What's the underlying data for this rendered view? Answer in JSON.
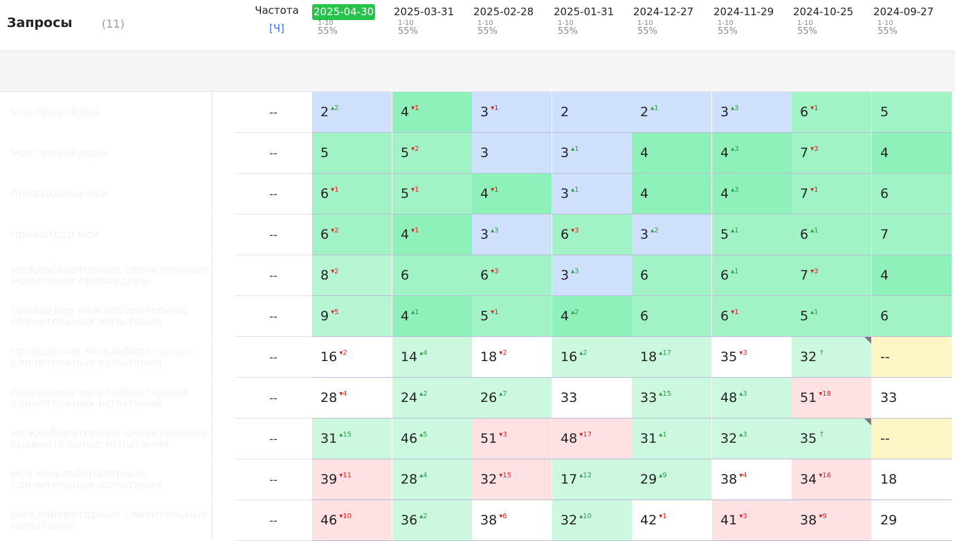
{
  "header": {
    "title": "Запросы",
    "count": "(11)",
    "freq_label": "Частота",
    "freq_unit": "[Ч]",
    "dates": [
      {
        "date": "2025-04-30",
        "range": "1-10",
        "pct": "55%",
        "active": true
      },
      {
        "date": "2025-03-31",
        "range": "1-10",
        "pct": "55%"
      },
      {
        "date": "2025-02-28",
        "range": "1-10",
        "pct": "55%"
      },
      {
        "date": "2025-01-31",
        "range": "1-10",
        "pct": "55%"
      },
      {
        "date": "2024-12-27",
        "range": "1-10",
        "pct": "55%"
      },
      {
        "date": "2024-11-29",
        "range": "1-10",
        "pct": "55%"
      },
      {
        "date": "2024-10-25",
        "range": "1-10",
        "pct": "55%"
      },
      {
        "date": "2024-09-27",
        "range": "1-10",
        "pct": "55%"
      }
    ]
  },
  "colors": {
    "active_date": "#27c24c",
    "blue": "#cfe0fc",
    "green_dark": "#8ef1b9",
    "green": "#a1f3c5",
    "green_light": "#b6f6d2",
    "green_pale": "#cdf8e0",
    "white": "#ffffff",
    "red": "#fde1e3",
    "yellow": "#fdf5c6",
    "up_arrow": "#2e9b48",
    "down_arrow": "#e02020"
  },
  "rows": [
    {
      "keyword": "мси провайдер",
      "freq": "--",
      "cells": [
        {
          "v": "2",
          "ch": "2",
          "dir": "up",
          "c": "blue"
        },
        {
          "v": "4",
          "ch": "1",
          "dir": "dn",
          "c": "g1"
        },
        {
          "v": "3",
          "ch": "1",
          "dir": "dn",
          "c": "blue"
        },
        {
          "v": "2",
          "c": "blue"
        },
        {
          "v": "2",
          "ch": "1",
          "dir": "up",
          "c": "blue"
        },
        {
          "v": "3",
          "ch": "3",
          "dir": "up",
          "c": "blue"
        },
        {
          "v": "6",
          "ch": "1",
          "dir": "dn",
          "c": "g2"
        },
        {
          "v": "5",
          "c": "g2"
        }
      ]
    },
    {
      "keyword": "мси провайдеры",
      "freq": "--",
      "cells": [
        {
          "v": "5",
          "c": "g2"
        },
        {
          "v": "5",
          "ch": "2",
          "dir": "dn",
          "c": "g2"
        },
        {
          "v": "3",
          "c": "blue"
        },
        {
          "v": "3",
          "ch": "1",
          "dir": "up",
          "c": "blue"
        },
        {
          "v": "4",
          "c": "g1"
        },
        {
          "v": "4",
          "ch": "3",
          "dir": "up",
          "c": "g1"
        },
        {
          "v": "7",
          "ch": "3",
          "dir": "dn",
          "c": "g2"
        },
        {
          "v": "4",
          "c": "g1"
        }
      ]
    },
    {
      "keyword": "провайдеры мси",
      "freq": "--",
      "cells": [
        {
          "v": "6",
          "ch": "1",
          "dir": "dn",
          "c": "g2"
        },
        {
          "v": "5",
          "ch": "1",
          "dir": "dn",
          "c": "g2"
        },
        {
          "v": "4",
          "ch": "1",
          "dir": "dn",
          "c": "g1"
        },
        {
          "v": "3",
          "ch": "1",
          "dir": "up",
          "c": "blue"
        },
        {
          "v": "4",
          "c": "g1"
        },
        {
          "v": "4",
          "ch": "3",
          "dir": "up",
          "c": "g1"
        },
        {
          "v": "7",
          "ch": "1",
          "dir": "dn",
          "c": "g2"
        },
        {
          "v": "6",
          "c": "g2"
        }
      ]
    },
    {
      "keyword": "провайдер мси",
      "freq": "--",
      "cells": [
        {
          "v": "6",
          "ch": "2",
          "dir": "dn",
          "c": "g2"
        },
        {
          "v": "4",
          "ch": "1",
          "dir": "dn",
          "c": "g1"
        },
        {
          "v": "3",
          "ch": "3",
          "dir": "up",
          "c": "blue"
        },
        {
          "v": "6",
          "ch": "3",
          "dir": "dn",
          "c": "g2"
        },
        {
          "v": "3",
          "ch": "2",
          "dir": "up",
          "c": "blue"
        },
        {
          "v": "5",
          "ch": "1",
          "dir": "up",
          "c": "g2"
        },
        {
          "v": "6",
          "ch": "1",
          "dir": "up",
          "c": "g2"
        },
        {
          "v": "7",
          "c": "g2"
        }
      ]
    },
    {
      "keyword": "межлабораторные сличительные испытания провайдеры",
      "freq": "--",
      "cells": [
        {
          "v": "8",
          "ch": "2",
          "dir": "dn",
          "c": "g3"
        },
        {
          "v": "6",
          "c": "g2"
        },
        {
          "v": "6",
          "ch": "3",
          "dir": "dn",
          "c": "g2"
        },
        {
          "v": "3",
          "ch": "3",
          "dir": "up",
          "c": "blue"
        },
        {
          "v": "6",
          "c": "g2"
        },
        {
          "v": "6",
          "ch": "1",
          "dir": "up",
          "c": "g2"
        },
        {
          "v": "7",
          "ch": "3",
          "dir": "dn",
          "c": "g2"
        },
        {
          "v": "4",
          "c": "g1"
        }
      ]
    },
    {
      "keyword": "провайдер межлабораторных сличительных испытаний",
      "freq": "--",
      "cells": [
        {
          "v": "9",
          "ch": "5",
          "dir": "dn",
          "c": "g3"
        },
        {
          "v": "4",
          "ch": "1",
          "dir": "up",
          "c": "g1"
        },
        {
          "v": "5",
          "ch": "1",
          "dir": "dn",
          "c": "g2"
        },
        {
          "v": "4",
          "ch": "2",
          "dir": "up",
          "c": "g1"
        },
        {
          "v": "6",
          "c": "g2"
        },
        {
          "v": "6",
          "ch": "1",
          "dir": "dn",
          "c": "g2"
        },
        {
          "v": "5",
          "ch": "1",
          "dir": "up",
          "c": "g2"
        },
        {
          "v": "6",
          "c": "g2"
        }
      ]
    },
    {
      "keyword": "проведение межлабораторных сличительных испытаний",
      "freq": "--",
      "cells": [
        {
          "v": "16",
          "ch": "2",
          "dir": "dn",
          "c": "w"
        },
        {
          "v": "14",
          "ch": "4",
          "dir": "up",
          "c": "g4"
        },
        {
          "v": "18",
          "ch": "2",
          "dir": "dn",
          "c": "w"
        },
        {
          "v": "16",
          "ch": "2",
          "dir": "up",
          "c": "g4"
        },
        {
          "v": "18",
          "ch": "17",
          "dir": "up",
          "c": "g4"
        },
        {
          "v": "35",
          "ch": "3",
          "dir": "dn",
          "c": "w"
        },
        {
          "v": "32",
          "ch": "↑",
          "dir": "up",
          "c": "g4",
          "corner": true
        },
        {
          "v": "--",
          "c": "y"
        }
      ]
    },
    {
      "keyword": "программа межлабораторных сличительных испытаний",
      "freq": "--",
      "cells": [
        {
          "v": "28",
          "ch": "4",
          "dir": "dn",
          "c": "w"
        },
        {
          "v": "24",
          "ch": "2",
          "dir": "up",
          "c": "g4"
        },
        {
          "v": "26",
          "ch": "7",
          "dir": "up",
          "c": "g4"
        },
        {
          "v": "33",
          "c": "w"
        },
        {
          "v": "33",
          "ch": "15",
          "dir": "up",
          "c": "g4"
        },
        {
          "v": "48",
          "ch": "3",
          "dir": "up",
          "c": "g4"
        },
        {
          "v": "51",
          "ch": "18",
          "dir": "dn",
          "c": "r"
        },
        {
          "v": "33",
          "c": "w"
        }
      ]
    },
    {
      "keyword": "межлабораторные сличительные сравнительные испытания",
      "freq": "--",
      "cells": [
        {
          "v": "31",
          "ch": "15",
          "dir": "up",
          "c": "g4"
        },
        {
          "v": "46",
          "ch": "5",
          "dir": "up",
          "c": "g4"
        },
        {
          "v": "51",
          "ch": "3",
          "dir": "dn",
          "c": "r"
        },
        {
          "v": "48",
          "ch": "17",
          "dir": "dn",
          "c": "r"
        },
        {
          "v": "31",
          "ch": "1",
          "dir": "up",
          "c": "g4"
        },
        {
          "v": "32",
          "ch": "3",
          "dir": "up",
          "c": "g4"
        },
        {
          "v": "35",
          "ch": "↑",
          "dir": "up",
          "c": "g4",
          "corner": true
        },
        {
          "v": "--",
          "c": "y"
        }
      ]
    },
    {
      "keyword": "мси межлабораторные сличительные испытания",
      "freq": "--",
      "cells": [
        {
          "v": "39",
          "ch": "11",
          "dir": "dn",
          "c": "r"
        },
        {
          "v": "28",
          "ch": "4",
          "dir": "up",
          "c": "g4"
        },
        {
          "v": "32",
          "ch": "15",
          "dir": "dn",
          "c": "r"
        },
        {
          "v": "17",
          "ch": "12",
          "dir": "up",
          "c": "g4"
        },
        {
          "v": "29",
          "ch": "9",
          "dir": "up",
          "c": "g4"
        },
        {
          "v": "38",
          "ch": "4",
          "dir": "dn",
          "c": "w"
        },
        {
          "v": "34",
          "ch": "16",
          "dir": "dn",
          "c": "r"
        },
        {
          "v": "18",
          "c": "w"
        }
      ]
    },
    {
      "keyword": "межлабораторные сличительные испытания",
      "freq": "--",
      "cells": [
        {
          "v": "46",
          "ch": "10",
          "dir": "dn",
          "c": "r"
        },
        {
          "v": "36",
          "ch": "2",
          "dir": "up",
          "c": "g4"
        },
        {
          "v": "38",
          "ch": "6",
          "dir": "dn",
          "c": "w"
        },
        {
          "v": "32",
          "ch": "10",
          "dir": "up",
          "c": "g4"
        },
        {
          "v": "42",
          "ch": "1",
          "dir": "dn",
          "c": "w"
        },
        {
          "v": "41",
          "ch": "3",
          "dir": "dn",
          "c": "r"
        },
        {
          "v": "38",
          "ch": "9",
          "dir": "dn",
          "c": "r"
        },
        {
          "v": "29",
          "c": "w"
        }
      ]
    }
  ]
}
